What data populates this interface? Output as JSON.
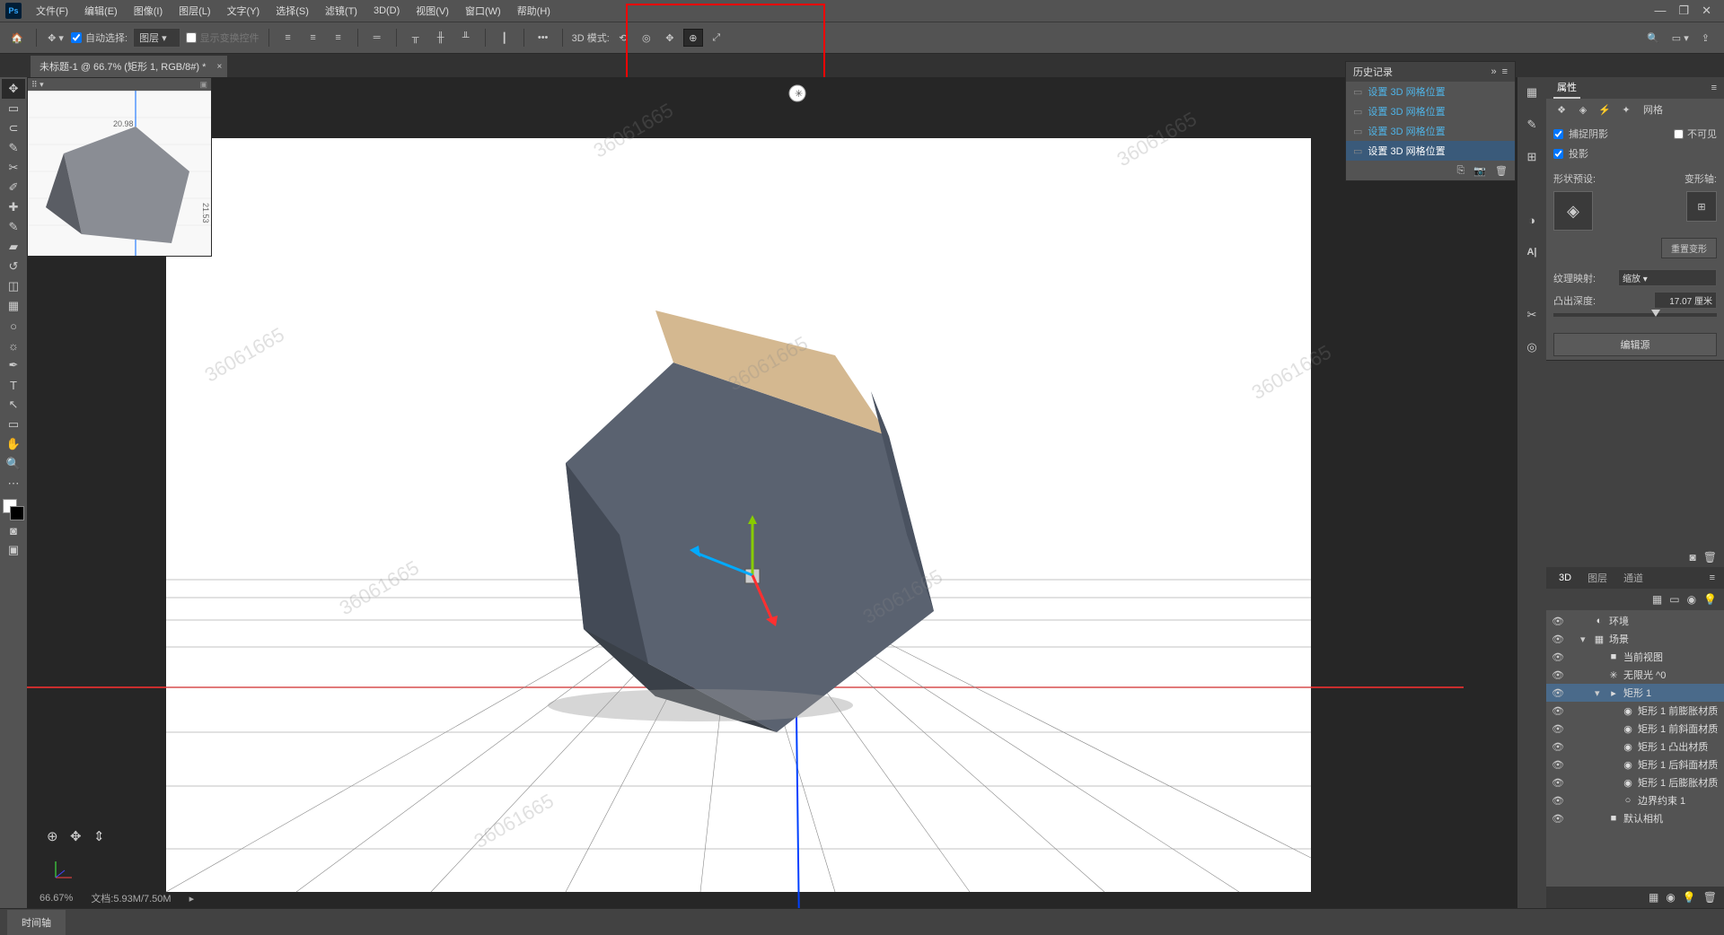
{
  "menu": [
    "文件(F)",
    "编辑(E)",
    "图像(I)",
    "图层(L)",
    "文字(Y)",
    "选择(S)",
    "滤镜(T)",
    "3D(D)",
    "视图(V)",
    "窗口(W)",
    "帮助(H)"
  ],
  "options": {
    "auto_select_label": "自动选择:",
    "target": "图层",
    "show_transform": "显示变换控件",
    "mode_label": "3D 模式:"
  },
  "tab_title": "未标题-1 @ 66.7% (矩形 1, RGB/8#) *",
  "nav": {
    "dim1": "20.98",
    "dim2": "21.53"
  },
  "status": {
    "zoom": "66.67%",
    "doc": "文档:5.93M/7.50M"
  },
  "history": {
    "title": "历史记录",
    "items": [
      "设置 3D 网格位置",
      "设置 3D 网格位置",
      "设置 3D 网格位置",
      "设置 3D 网格位置"
    ]
  },
  "properties": {
    "title": "属性",
    "mesh_label": "网格",
    "catch_shadow": "捕捉阴影",
    "invisible": "不可见",
    "cast_shadow": "投影",
    "shape_preset": "形状预设:",
    "deform_axis": "变形轴:",
    "reset_deform": "重置变形",
    "texture_map": "纹理映射:",
    "texture_val": "缩放",
    "extrude_depth": "凸出深度:",
    "extrude_val": "17.07 厘米",
    "edit_source": "编辑源"
  },
  "scene": {
    "tabs": [
      "3D",
      "图层",
      "通道"
    ],
    "rows": [
      {
        "label": "环境",
        "icon": "◐",
        "indent": 0
      },
      {
        "label": "场景",
        "icon": "▦",
        "indent": 0,
        "expand": "▾"
      },
      {
        "label": "当前视图",
        "icon": "■",
        "indent": 1
      },
      {
        "label": "无限光 ^0",
        "icon": "✳",
        "indent": 1
      },
      {
        "label": "矩形 1",
        "icon": "▸",
        "indent": 1,
        "sel": true,
        "expand": "▾"
      },
      {
        "label": "矩形 1 前膨胀材质",
        "icon": "◉",
        "indent": 2
      },
      {
        "label": "矩形 1 前斜面材质",
        "icon": "◉",
        "indent": 2
      },
      {
        "label": "矩形 1 凸出材质",
        "icon": "◉",
        "indent": 2
      },
      {
        "label": "矩形 1 后斜面材质",
        "icon": "◉",
        "indent": 2
      },
      {
        "label": "矩形 1 后膨胀材质",
        "icon": "◉",
        "indent": 2
      },
      {
        "label": "边界约束 1",
        "icon": "○",
        "indent": 2
      },
      {
        "label": "默认相机",
        "icon": "■",
        "indent": 1
      }
    ]
  },
  "bottom_tab": "时间轴",
  "watermark": "36061665"
}
